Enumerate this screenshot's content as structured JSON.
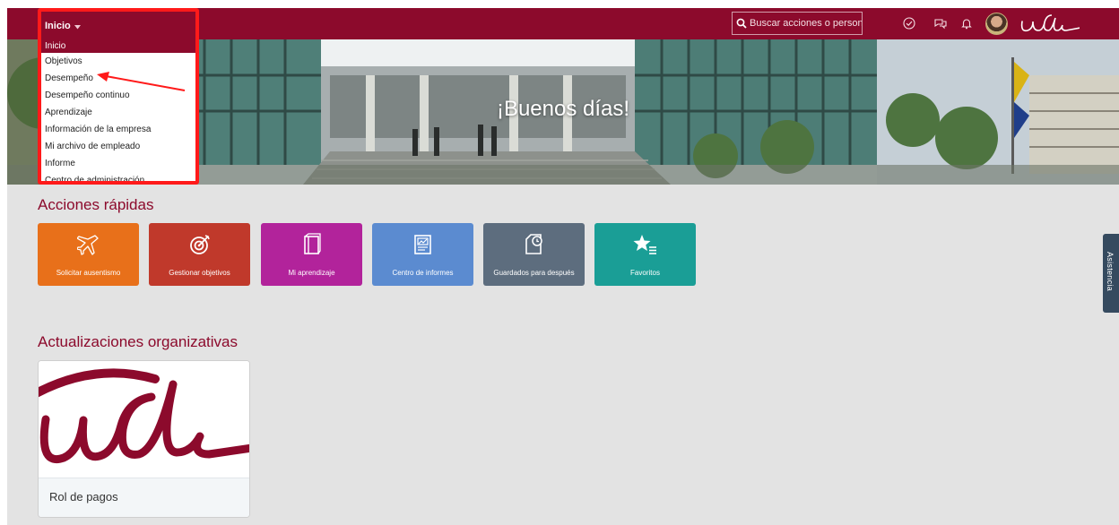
{
  "topbar": {
    "menu_title": "Inicio",
    "search_placeholder": "Buscar acciones o personas",
    "icons": [
      "search-icon",
      "checkmark-icon",
      "feedback-icon",
      "bell-icon",
      "avatar",
      "udla-logo"
    ],
    "brand_color": "#8c0a2c"
  },
  "menu": {
    "items": [
      {
        "label": "Inicio",
        "active": true
      },
      {
        "label": "Objetivos"
      },
      {
        "label": "Desempeño"
      },
      {
        "label": "Desempeño continuo"
      },
      {
        "label": "Aprendizaje"
      },
      {
        "label": "Información de la empresa"
      },
      {
        "label": "Mi archivo de empleado"
      },
      {
        "label": "Informe"
      },
      {
        "label": "Centro de administración"
      }
    ],
    "highlight_color": "#ff1a1a"
  },
  "hero": {
    "greeting": "¡Buenos días!"
  },
  "quick_actions": {
    "title": "Acciones rápidas",
    "tiles": [
      {
        "label": "Solicitar ausentismo",
        "icon": "airplane-icon",
        "color": "#e8701a"
      },
      {
        "label": "Gestionar objetivos",
        "icon": "target-icon",
        "color": "#c0392b"
      },
      {
        "label": "Mi aprendizaje",
        "icon": "book-icon",
        "color": "#b2239b"
      },
      {
        "label": "Centro de informes",
        "icon": "report-icon",
        "color": "#5b8bd0"
      },
      {
        "label": "Guardados para después",
        "icon": "saved-later-icon",
        "color": "#5d6d7e"
      },
      {
        "label": "Favoritos",
        "icon": "star-list-icon",
        "color": "#1a9e96"
      }
    ]
  },
  "side_tab": {
    "label": "Asistencia"
  },
  "org_updates": {
    "title": "Actualizaciones organizativas",
    "cards": [
      {
        "title": "Rol de pagos",
        "image": "udla-logo"
      }
    ]
  }
}
